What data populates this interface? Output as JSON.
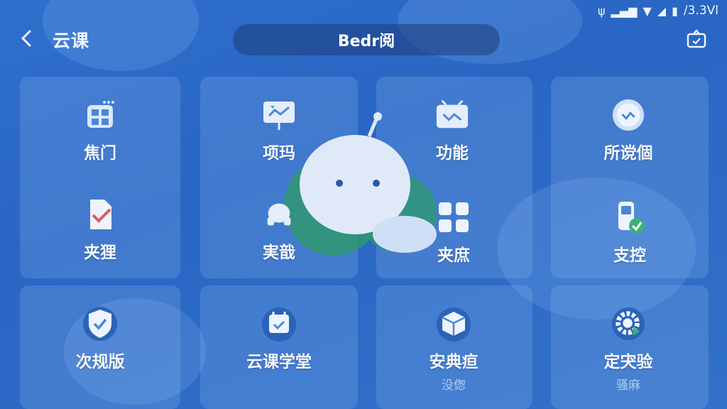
{
  "status_bar": {
    "battery_text": "/3.3Vl"
  },
  "header": {
    "back_icon": "back-arrow-icon",
    "app_title": "云课",
    "title": "Bedr阅",
    "share_icon": "share-icon"
  },
  "grid": {
    "items": [
      {
        "label": "焦门",
        "icon": "grid-calendar-icon"
      },
      {
        "label": "项玛",
        "icon": "presentation-board-icon"
      },
      {
        "label": "功能",
        "icon": "tv-screen-icon"
      },
      {
        "label": "所谠個",
        "icon": "wave-circle-icon"
      },
      {
        "label": "夹狸",
        "icon": "document-check-icon"
      },
      {
        "label": "実戠",
        "icon": "robot-cloud-icon"
      },
      {
        "label": "夹庶",
        "icon": "apps-grid-icon"
      },
      {
        "label": "支控",
        "icon": "device-check-icon"
      },
      {
        "label": "次规版",
        "icon": "shield-check-icon"
      },
      {
        "label": "云课学堂",
        "icon": "calendar-check-icon"
      },
      {
        "label": "安典疸",
        "icon": "cube-box-icon",
        "sublabel": "没偬"
      },
      {
        "label": "定宊验",
        "icon": "gear-play-icon",
        "sublabel": "骚麻"
      }
    ]
  },
  "colors": {
    "background": "#2f6fcc",
    "accent_green": "#3bb07a",
    "pill": "#1e3c78"
  }
}
